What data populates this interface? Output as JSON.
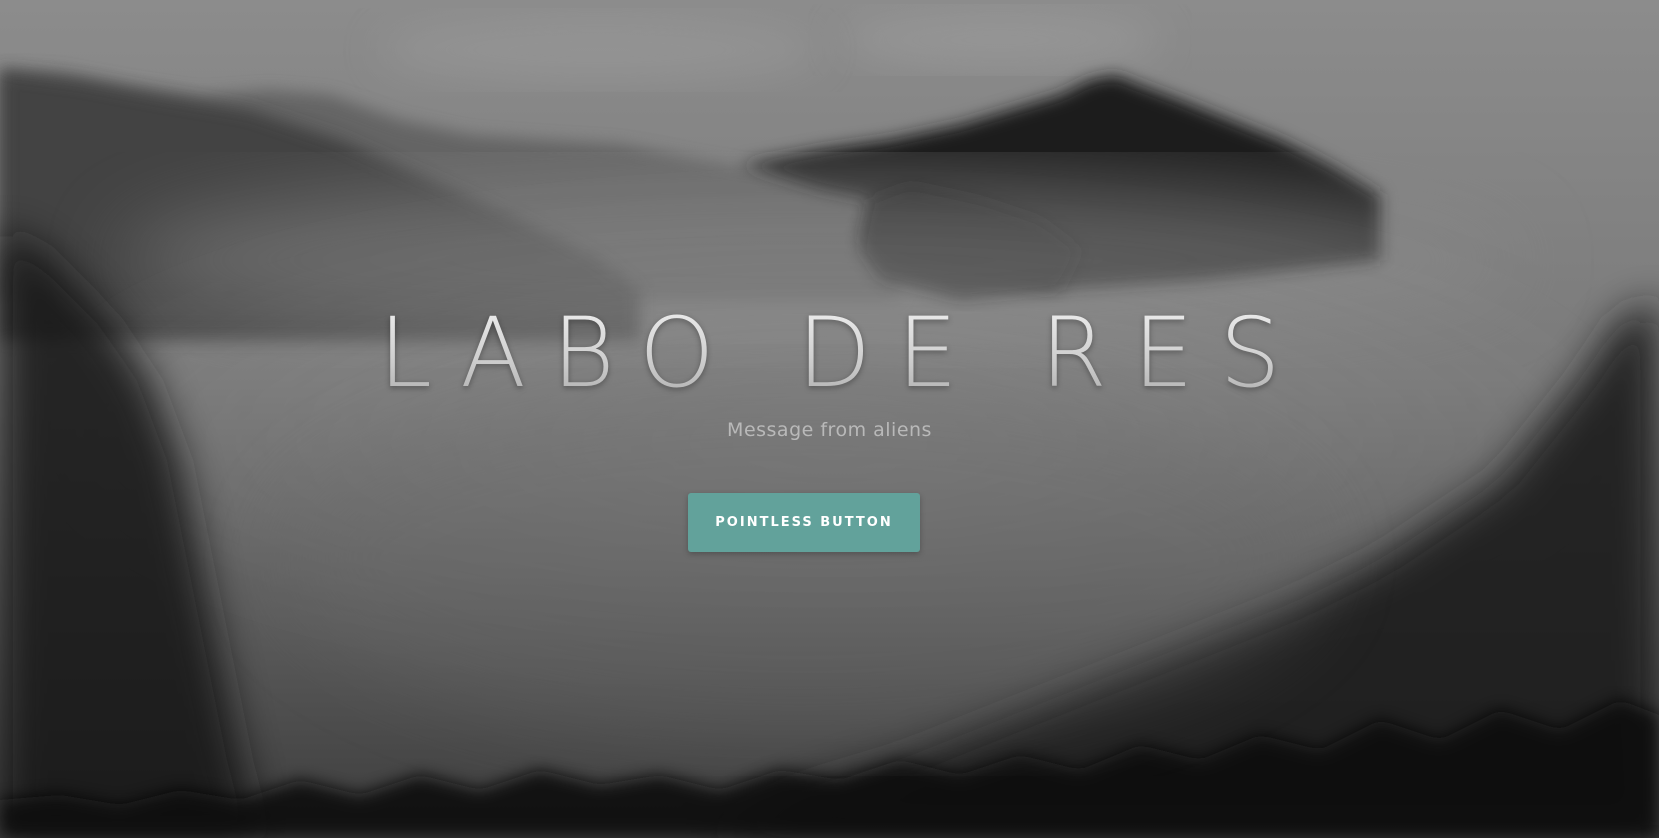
{
  "hero": {
    "title": "LABO DE RES",
    "subtitle": "Message from aliens",
    "button_label": "POINTLESS BUTTON"
  },
  "colors": {
    "button_background": "#62a29b",
    "button_text": "#ffffff",
    "title_text": "#d8d8d8",
    "subtitle_text": "#b9b9b9",
    "background_tone": "#3a3a3a"
  },
  "background_image": "misty-mountain-forest-grayscale"
}
